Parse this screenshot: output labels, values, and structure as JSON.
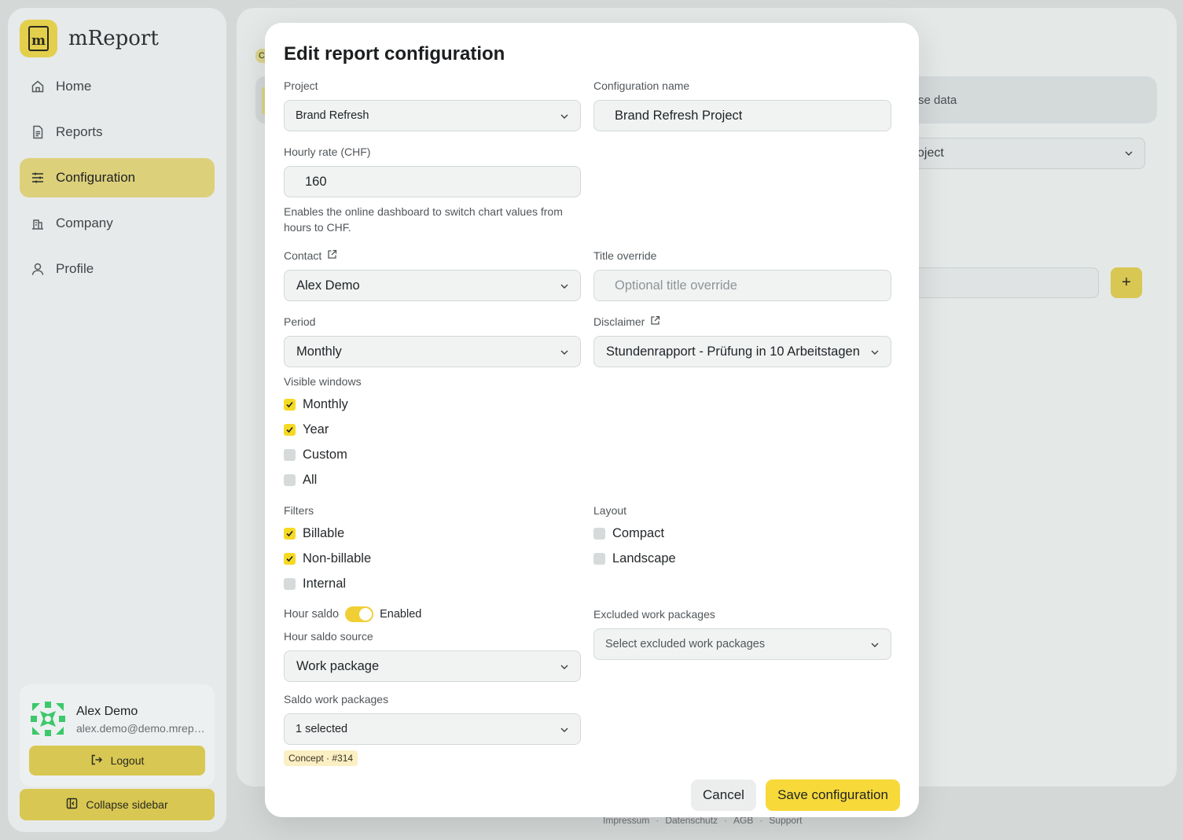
{
  "app": {
    "name": "mReport",
    "logo_letter": "m"
  },
  "sidebar": {
    "items": [
      {
        "label": "Home",
        "icon": "home-icon"
      },
      {
        "label": "Reports",
        "icon": "document-icon"
      },
      {
        "label": "Configuration",
        "icon": "sliders-icon",
        "active": true
      },
      {
        "label": "Company",
        "icon": "building-icon"
      },
      {
        "label": "Profile",
        "icon": "user-icon"
      }
    ],
    "user": {
      "name": "Alex Demo",
      "email": "alex.demo@demo.mreport.ch"
    },
    "logout_label": "Logout",
    "collapse_label": "Collapse sidebar"
  },
  "background": {
    "chip_text": "C",
    "tab_text": "se data",
    "select_text": "oject",
    "plus_label": "+"
  },
  "footer": {
    "links": [
      "Impressum",
      "Datenschutz",
      "AGB",
      "Support"
    ]
  },
  "modal": {
    "title": "Edit report configuration",
    "project": {
      "label": "Project",
      "value": "Brand Refresh"
    },
    "config_name": {
      "label": "Configuration name",
      "value": "Brand Refresh Project"
    },
    "hourly_rate": {
      "label": "Hourly rate (CHF)",
      "value": "160",
      "help": "Enables the online dashboard to switch chart values from hours to CHF."
    },
    "contact": {
      "label": "Contact",
      "value": "Alex Demo"
    },
    "title_override": {
      "label": "Title override",
      "placeholder": "Optional title override"
    },
    "period": {
      "label": "Period",
      "value": "Monthly"
    },
    "disclaimer": {
      "label": "Disclaimer",
      "value": "Stundenrapport - Prüfung in 10 Arbeitstagen"
    },
    "visible_windows": {
      "label": "Visible windows",
      "options": [
        {
          "label": "Monthly",
          "checked": true
        },
        {
          "label": "Year",
          "checked": true
        },
        {
          "label": "Custom",
          "checked": false
        },
        {
          "label": "All",
          "checked": false
        }
      ]
    },
    "filters": {
      "label": "Filters",
      "options": [
        {
          "label": "Billable",
          "checked": true
        },
        {
          "label": "Non-billable",
          "checked": true
        },
        {
          "label": "Internal",
          "checked": false
        }
      ]
    },
    "layout": {
      "label": "Layout",
      "options": [
        {
          "label": "Compact",
          "checked": false
        },
        {
          "label": "Landscape",
          "checked": false
        }
      ]
    },
    "hour_saldo": {
      "label": "Hour saldo",
      "state": "Enabled",
      "on": true
    },
    "hour_saldo_source": {
      "label": "Hour saldo source",
      "value": "Work package"
    },
    "saldo_work_packages": {
      "label": "Saldo work packages",
      "value": "1 selected",
      "chip": "Concept · #314"
    },
    "excluded_work_packages": {
      "label": "Excluded work packages",
      "placeholder": "Select excluded work packages"
    },
    "cancel_label": "Cancel",
    "save_label": "Save configuration"
  },
  "colors": {
    "accent": "#f7d93a",
    "checkbox_on": "#f5da24",
    "sidebar_active": "#ddd07a"
  }
}
